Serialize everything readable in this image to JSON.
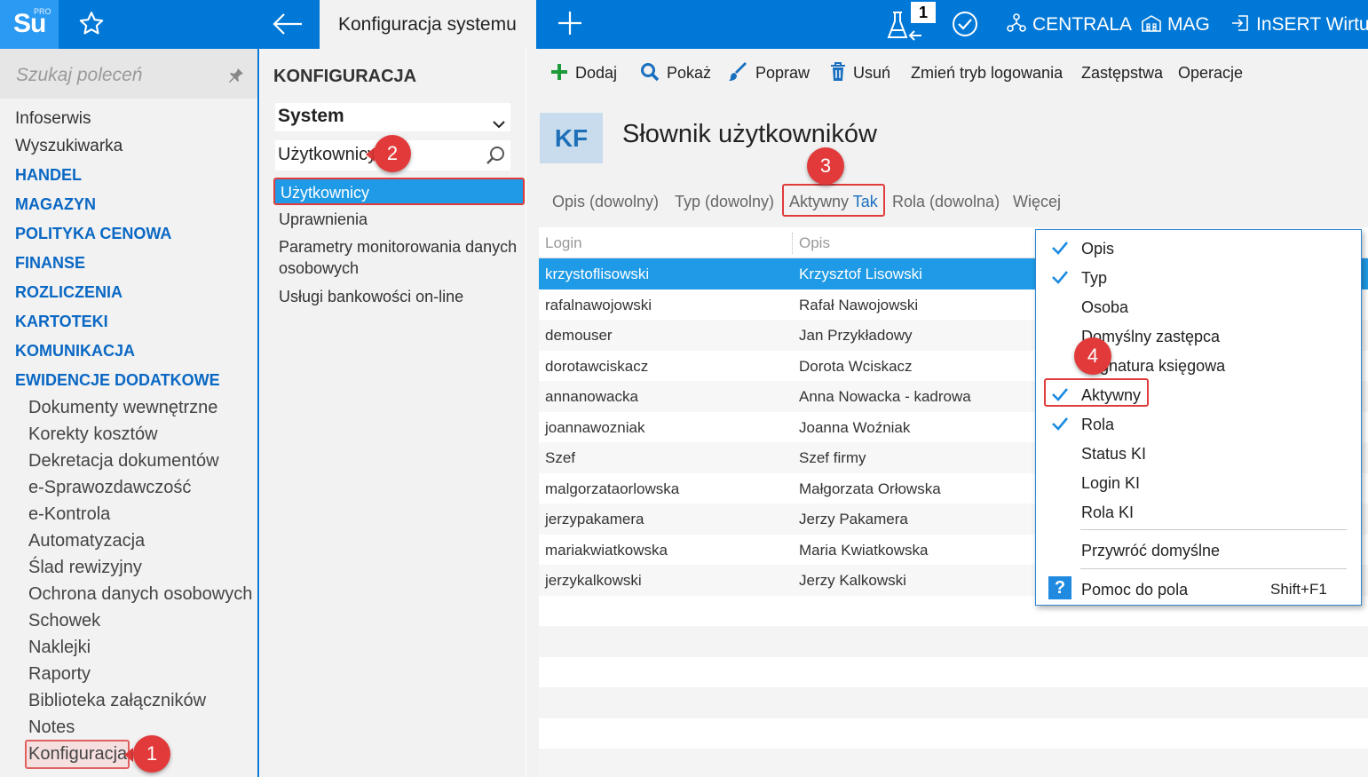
{
  "topbar": {
    "logo_main": "Su",
    "logo_sup": "PRO",
    "active_tab": "Konfiguracja systemu",
    "tasks_badge": "1",
    "company": "CENTRALA",
    "warehouse": "MAG",
    "user": "InSERT Wirtua"
  },
  "sidebar": {
    "search_placeholder": "Szukaj poleceń",
    "items": [
      {
        "label": "Infoserwis",
        "type": "plain"
      },
      {
        "label": "Wyszukiwarka",
        "type": "plain"
      },
      {
        "label": "HANDEL",
        "type": "module"
      },
      {
        "label": "MAGAZYN",
        "type": "module"
      },
      {
        "label": "POLITYKA CENOWA",
        "type": "module"
      },
      {
        "label": "FINANSE",
        "type": "module"
      },
      {
        "label": "ROZLICZENIA",
        "type": "module"
      },
      {
        "label": "KARTOTEKI",
        "type": "module"
      },
      {
        "label": "KOMUNIKACJA",
        "type": "module"
      },
      {
        "label": "EWIDENCJE DODATKOWE",
        "type": "module"
      }
    ],
    "subitems": [
      "Dokumenty wewnętrzne",
      "Korekty kosztów",
      "Dekretacja dokumentów",
      "e-Sprawozdawczość",
      "e-Kontrola",
      "Automatyzacja",
      "Ślad rewizyjny",
      "Ochrona danych osobowych",
      "Schowek",
      "Naklejki",
      "Raporty",
      "Biblioteka załączników",
      "Notes",
      "Konfiguracja"
    ]
  },
  "config": {
    "title": "KONFIGURACJA",
    "select_value": "System",
    "search_value": "Użytkownicy",
    "items": [
      "Użytkownicy",
      "Uprawnienia",
      "Parametry monitorowania danych",
      "osobowych",
      "Usługi bankowości on-line"
    ]
  },
  "toolbar": {
    "add": "Dodaj",
    "show": "Pokaż",
    "edit": "Popraw",
    "delete": "Usuń",
    "change_login": "Zmień tryb logowania",
    "substitutes": "Zastępstwa",
    "operations": "Operacje"
  },
  "page": {
    "badge": "KF",
    "title": "Słownik użytkowników"
  },
  "filters": {
    "opis": "Opis (dowolny)",
    "typ": "Typ (dowolny)",
    "aktywny_label": "Aktywny",
    "aktywny_value": "Tak",
    "rola": "Rola (dowolna)",
    "more": "Więcej"
  },
  "grid": {
    "col_login": "Login",
    "col_opis": "Opis",
    "rows": [
      {
        "login": "krzystoflisowski",
        "opis": "Krzysztof Lisowski"
      },
      {
        "login": "rafalnawojowski",
        "opis": "Rafał Nawojowski"
      },
      {
        "login": "demouser",
        "opis": "Jan Przykładowy"
      },
      {
        "login": "dorotawciskacz",
        "opis": "Dorota Wciskacz"
      },
      {
        "login": "annanowacka",
        "opis": "Anna Nowacka - kadrowa"
      },
      {
        "login": "joannawozniak",
        "opis": "Joanna Woźniak"
      },
      {
        "login": "Szef",
        "opis": "Szef firmy"
      },
      {
        "login": "malgorzataorlowska",
        "opis": "Małgorzata Orłowska"
      },
      {
        "login": "jerzypakamera",
        "opis": "Jerzy Pakamera"
      },
      {
        "login": "mariakwiatkowska",
        "opis": "Maria Kwiatkowska"
      },
      {
        "login": "jerzykalkowski",
        "opis": "Jerzy Kalkowski"
      }
    ]
  },
  "popup": {
    "items": [
      {
        "label": "Opis",
        "checked": true
      },
      {
        "label": "Typ",
        "checked": true
      },
      {
        "label": "Osoba",
        "checked": false
      },
      {
        "label": "Domyślny zastępca",
        "checked": false
      },
      {
        "label": "Sygnatura księgowa",
        "checked": false
      },
      {
        "label": "Aktywny",
        "checked": true
      },
      {
        "label": "Rola",
        "checked": true
      },
      {
        "label": "Status KI",
        "checked": false
      },
      {
        "label": "Login KI",
        "checked": false
      },
      {
        "label": "Rola KI",
        "checked": false
      }
    ],
    "restore": "Przywróć domyślne",
    "help_icon": "?",
    "help": "Pomoc do pola",
    "help_shortcut": "Shift+F1"
  },
  "annotations": [
    "1",
    "2",
    "3",
    "4"
  ],
  "colors": {
    "accent": "#0078d7",
    "selection": "#1f9ae6",
    "annotation": "#e23a3a"
  }
}
